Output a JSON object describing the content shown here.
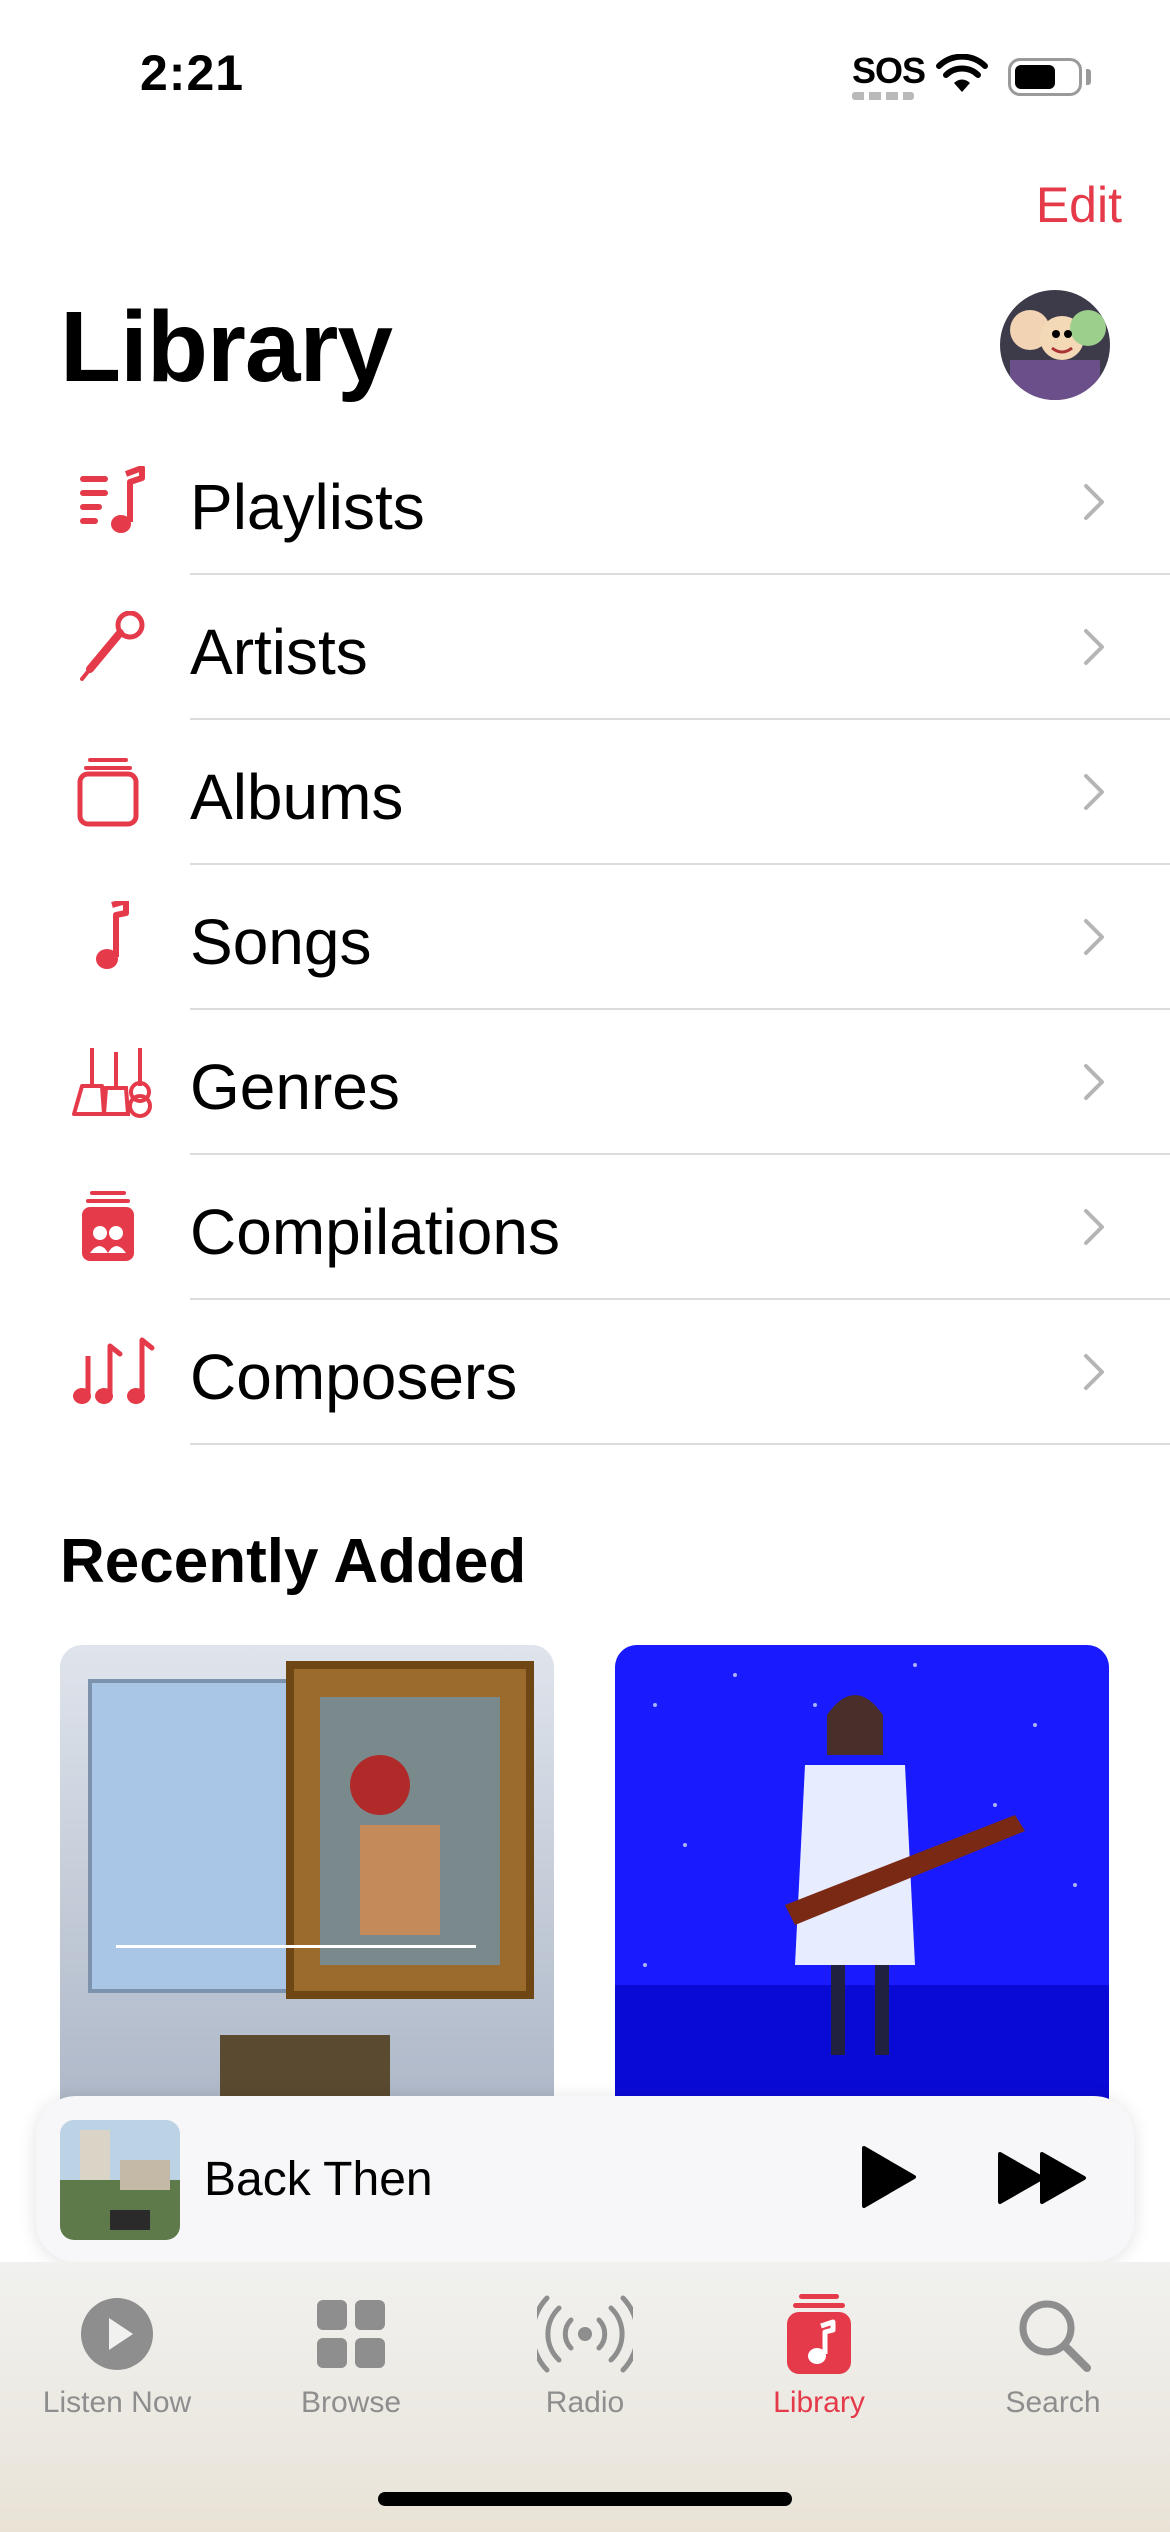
{
  "status_bar": {
    "time": "2:21",
    "sos": "SOS"
  },
  "header": {
    "edit_label": "Edit",
    "title": "Library"
  },
  "menu": [
    {
      "label": "Playlists",
      "icon": "playlist-icon"
    },
    {
      "label": "Artists",
      "icon": "microphone-icon"
    },
    {
      "label": "Albums",
      "icon": "album-stack-icon"
    },
    {
      "label": "Songs",
      "icon": "music-note-icon"
    },
    {
      "label": "Genres",
      "icon": "guitars-icon"
    },
    {
      "label": "Compilations",
      "icon": "compilation-icon"
    },
    {
      "label": "Composers",
      "icon": "composer-notes-icon"
    }
  ],
  "recently_added": {
    "title": "Recently Added"
  },
  "mini_player": {
    "title": "Back Then"
  },
  "tabs": [
    {
      "label": "Listen Now",
      "icon": "play-circle-icon"
    },
    {
      "label": "Browse",
      "icon": "grid-icon"
    },
    {
      "label": "Radio",
      "icon": "radio-waves-icon"
    },
    {
      "label": "Library",
      "icon": "library-icon",
      "active": true
    },
    {
      "label": "Search",
      "icon": "magnifier-icon"
    }
  ],
  "colors": {
    "accent": "#e53a4a",
    "inactive": "#8e8e8e"
  }
}
